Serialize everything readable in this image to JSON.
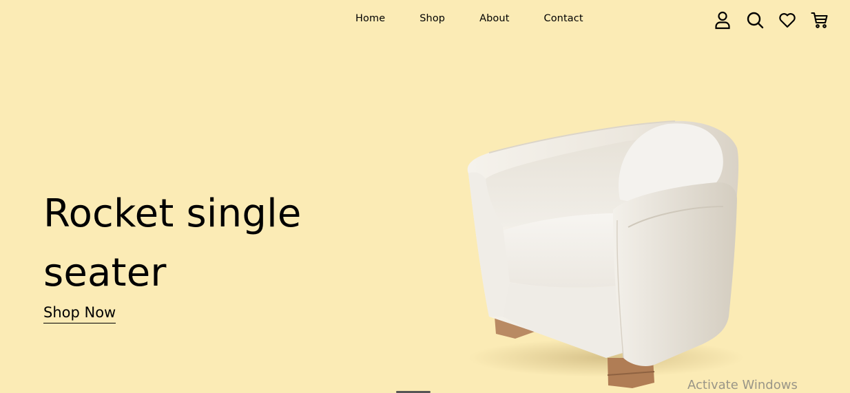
{
  "nav": {
    "items": [
      {
        "label": "Home"
      },
      {
        "label": "Shop"
      },
      {
        "label": "About"
      },
      {
        "label": "Contact"
      }
    ]
  },
  "header_icons": [
    "account-icon",
    "search-icon",
    "heart-icon",
    "cart-icon"
  ],
  "hero": {
    "title": "Rocket single seater",
    "cta_label": "Shop Now"
  },
  "watermark": "Activate Windows",
  "colors": {
    "background": "#FBEBB5",
    "text": "#000000"
  }
}
